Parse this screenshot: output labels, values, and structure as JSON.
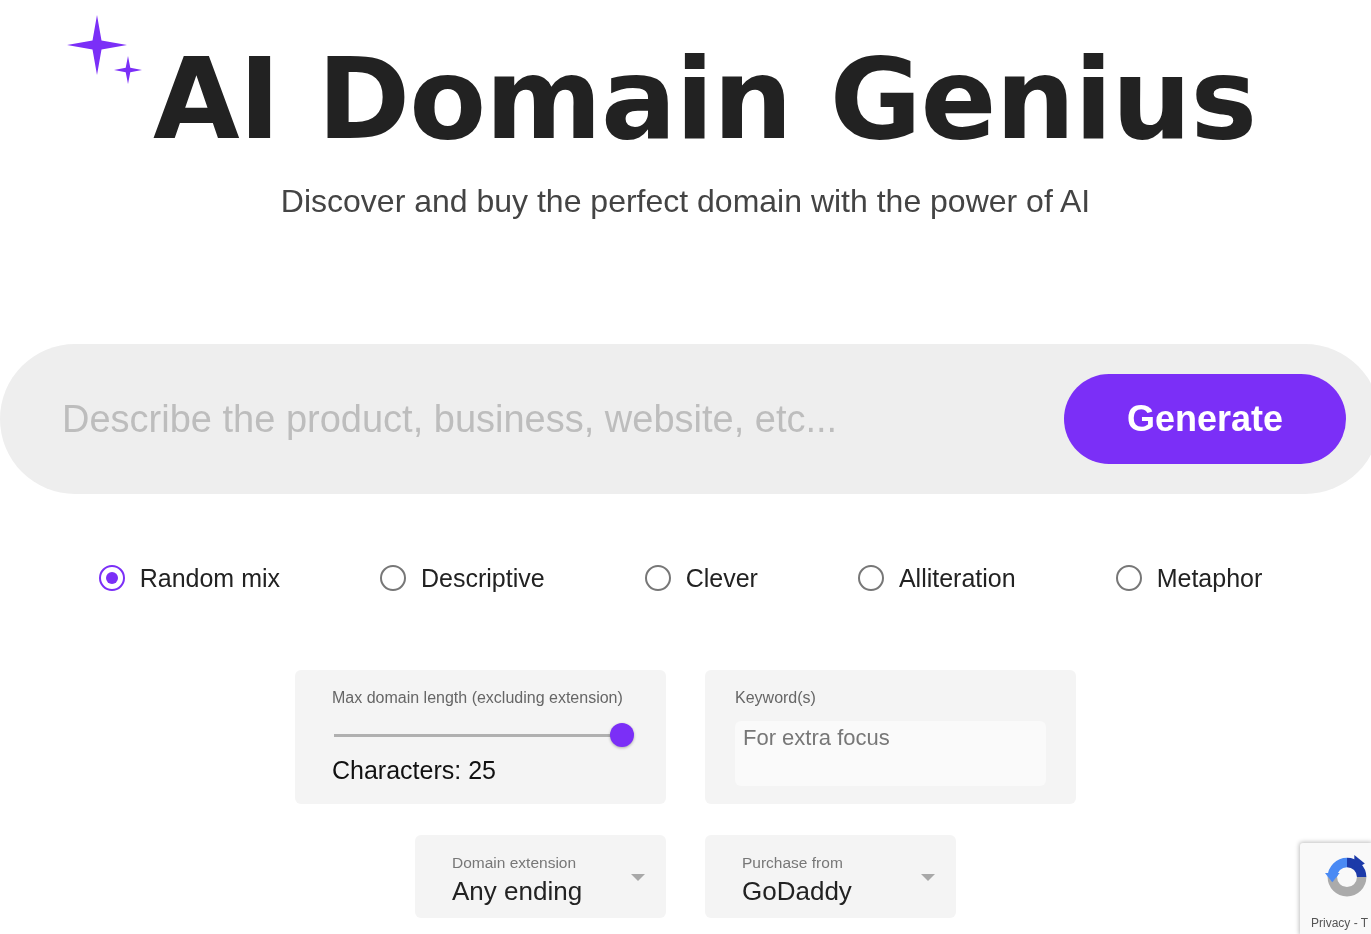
{
  "header": {
    "title": "AI Domain Genius",
    "subtitle": "Discover and buy the perfect domain with the power of AI"
  },
  "search": {
    "placeholder": "Describe the product, business, website, etc...",
    "button": "Generate"
  },
  "styles": [
    {
      "label": "Random mix",
      "selected": true
    },
    {
      "label": "Descriptive",
      "selected": false
    },
    {
      "label": "Clever",
      "selected": false
    },
    {
      "label": "Alliteration",
      "selected": false
    },
    {
      "label": "Metaphor",
      "selected": false
    }
  ],
  "settings": [
    {
      "cards": [
        {
          "kind": "slider",
          "label": "Max domain length (excluding extension)",
          "level": 1,
          "reading": "Characters: 25"
        },
        {
          "kind": "text",
          "label": "Keyword(s)",
          "placeholder": "For extra focus"
        }
      ]
    },
    {
      "cards": [
        {
          "kind": "select",
          "label": "Domain extension",
          "value": "Any ending"
        },
        {
          "kind": "select",
          "label": "Purchase from",
          "value": "GoDaddy"
        }
      ]
    }
  ],
  "recaptcha": {
    "links": "Privacy - T"
  }
}
